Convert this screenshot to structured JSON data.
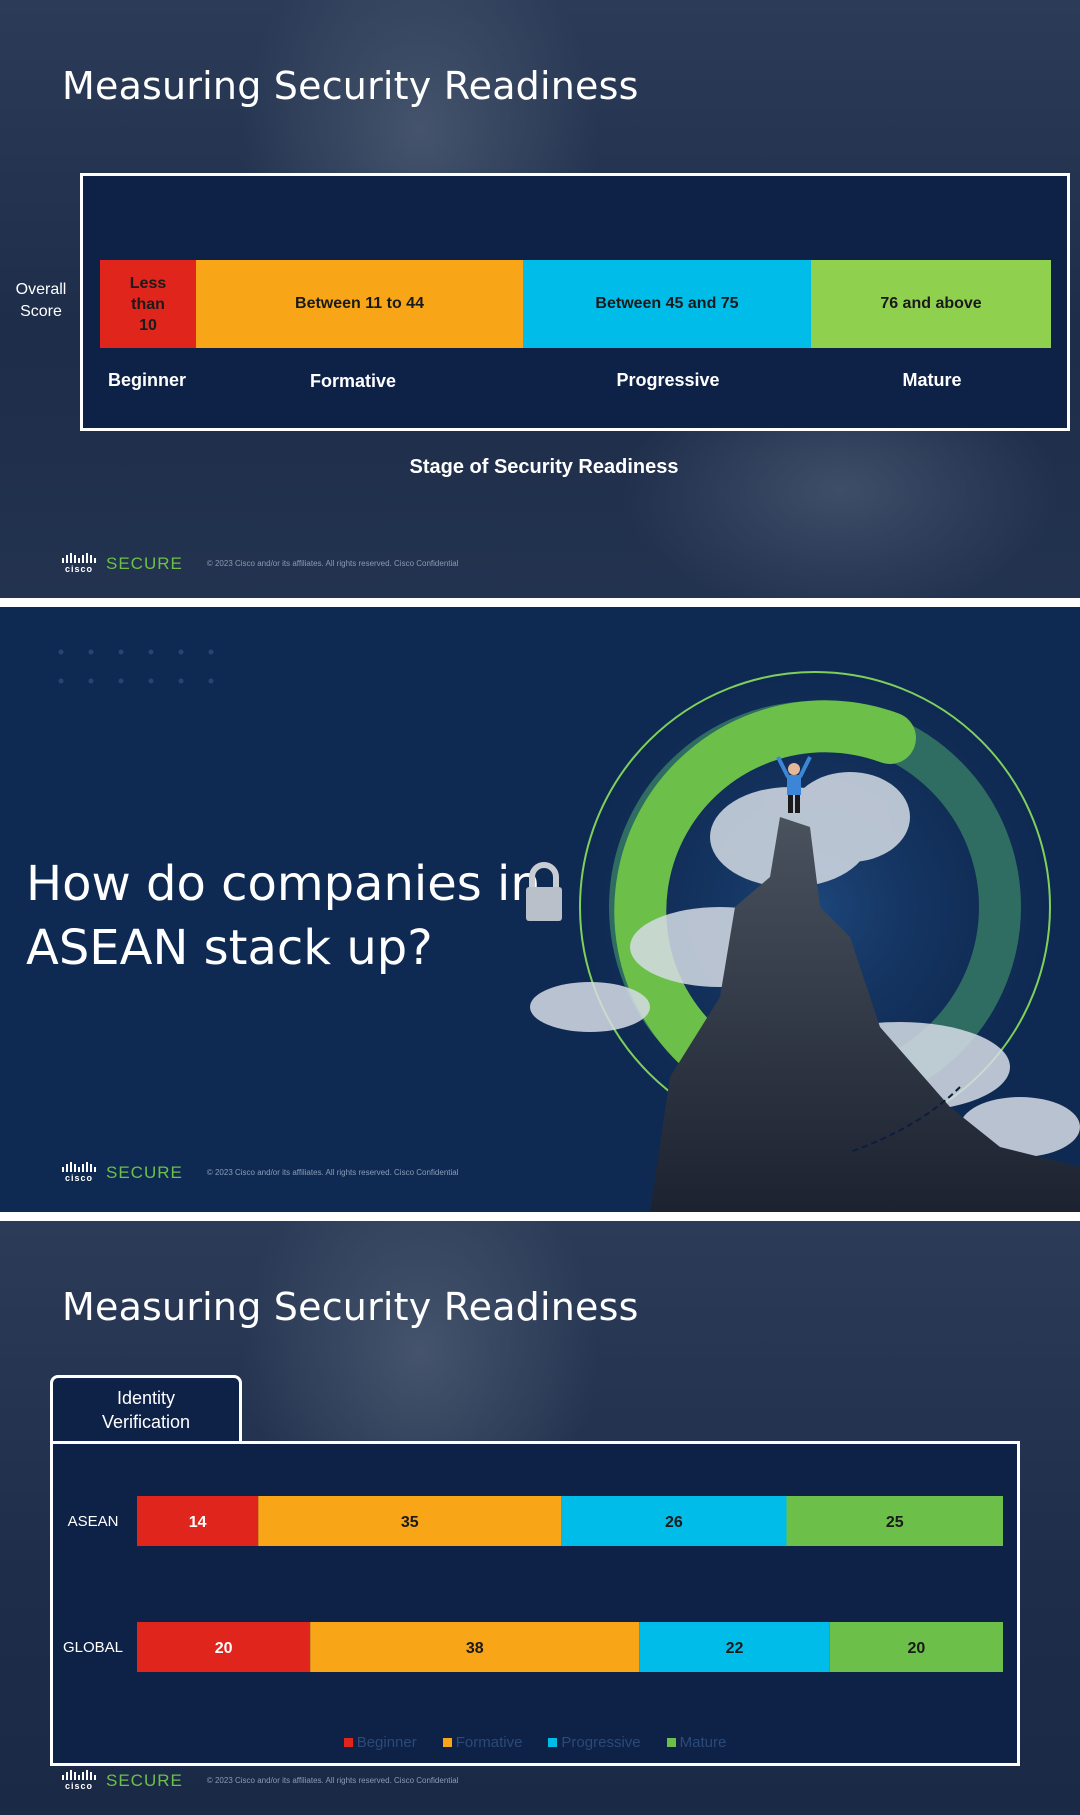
{
  "slide1": {
    "title": "Measuring Security Readiness",
    "y_label_line1": "Overall",
    "y_label_line2": "Score",
    "segments": [
      {
        "line1": "Less",
        "line2": "than",
        "line3": "10",
        "color": "#e0251d"
      },
      {
        "label": "Between 11 to 44",
        "color": "#f8a618"
      },
      {
        "label": "Between 45 and 75",
        "color": "#00bce9"
      },
      {
        "label": "76 and above",
        "color": "#8fd14f"
      }
    ],
    "stages": [
      "Beginner",
      "Formative",
      "Progressive",
      "Mature"
    ],
    "caption": "Stage of Security Readiness"
  },
  "footer": {
    "cisco": "cisco",
    "secure": "SECURE",
    "legal": "© 2023 Cisco and/or its affiliates. All rights reserved. Cisco Confidential"
  },
  "slide2": {
    "headline_line1": "How do companies in",
    "headline_line2": "ASEAN stack up?"
  },
  "slide3": {
    "title": "Measuring Security Readiness",
    "tab_line1": "Identity",
    "tab_line2": "Verification",
    "legend": [
      "Beginner",
      "Formative",
      "Progressive",
      "Mature"
    ],
    "colors": [
      "#e0251d",
      "#f8a618",
      "#00bce9",
      "#6cc04a"
    ]
  },
  "chart_data": {
    "type": "bar",
    "stacked": true,
    "orientation": "horizontal",
    "title": "Identity Verification",
    "categories": [
      "ASEAN",
      "GLOBAL"
    ],
    "series": [
      {
        "name": "Beginner",
        "values": [
          14,
          20
        ]
      },
      {
        "name": "Formative",
        "values": [
          35,
          38
        ]
      },
      {
        "name": "Progressive",
        "values": [
          26,
          22
        ]
      },
      {
        "name": "Mature",
        "values": [
          25,
          20
        ]
      }
    ],
    "xlim": [
      0,
      100
    ],
    "legend_position": "bottom"
  }
}
